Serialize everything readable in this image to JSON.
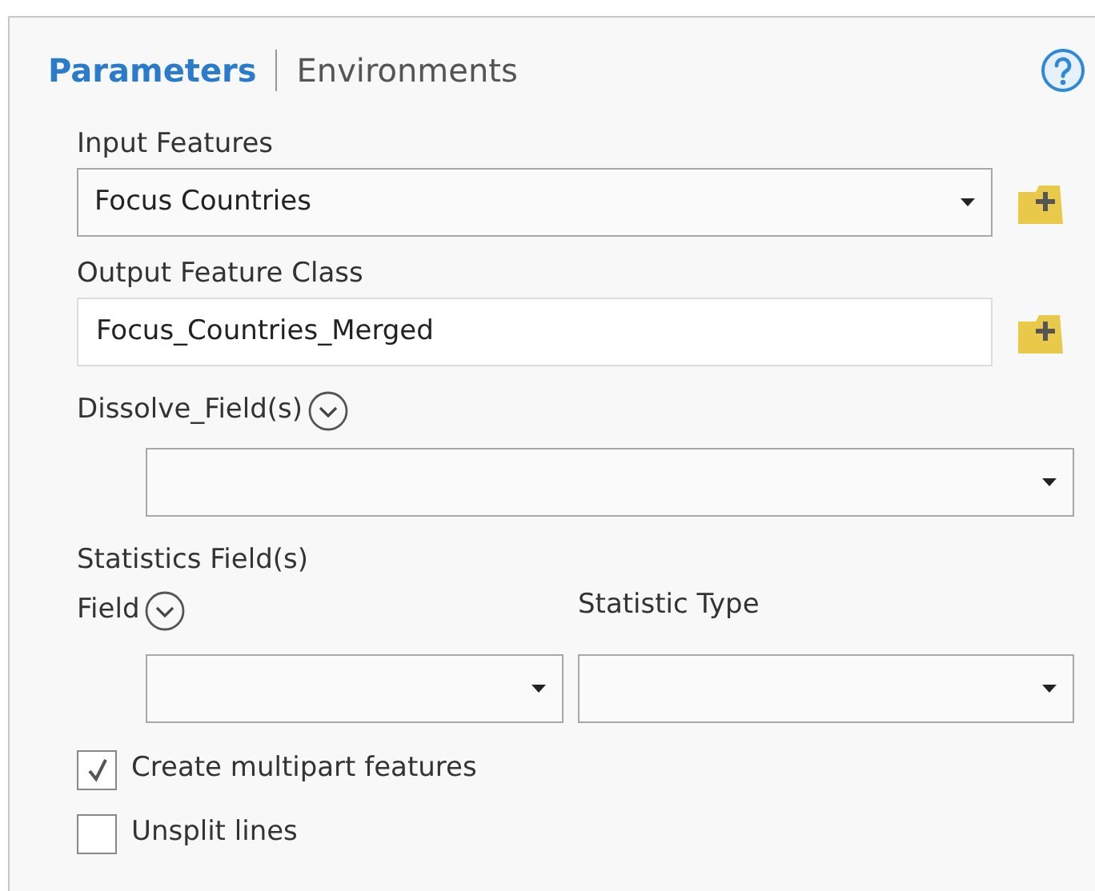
{
  "tabs": [
    {
      "label": "Parameters",
      "selected": true
    },
    {
      "label": "Environments",
      "selected": false
    }
  ],
  "input_features": {
    "label": "Input Features",
    "value": "Focus Countries"
  },
  "output_feature_class": {
    "label": "Output Feature Class",
    "value": "Focus_Countries_Merged"
  },
  "dissolve_fields": {
    "label": "Dissolve_Field(s)"
  },
  "statistics_fields": {
    "label": "Statistics Field(s)",
    "field_label": "Field",
    "type_label": "Statistic Type"
  },
  "options": [
    {
      "label": "Create multipart features",
      "checked": true
    },
    {
      "label": "Unsplit lines",
      "checked": false
    }
  ]
}
